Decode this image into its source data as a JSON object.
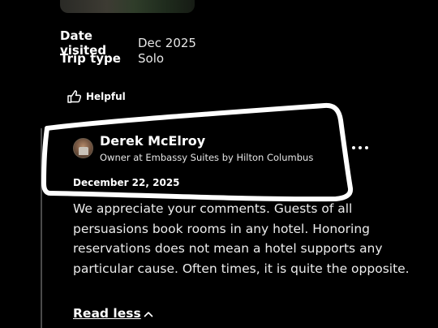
{
  "visit": {
    "date_label": "Date visited",
    "date_value": "Dec 2025",
    "trip_label": "Trip type",
    "trip_value": "Solo"
  },
  "actions": {
    "helpful_label": "Helpful",
    "helpful_icon": "thumbs-up-icon",
    "more_icon": "more-horizontal-icon"
  },
  "reply": {
    "owner_name": "Derek McElroy",
    "owner_role": "Owner at Embassy Suites by Hilton Columbus",
    "date": "December 22, 2025",
    "body": "We appreciate your comments. Guests of all persuasions book rooms in any hotel. Honoring reservations does not mean a hotel supports any particular cause. Often times, it is quite the opposite.",
    "read_less_label": "Read less",
    "read_less_icon": "chevron-up-icon"
  },
  "colors": {
    "background": "#000000",
    "text": "#ffffff",
    "highlight_outline": "#ffffff"
  }
}
